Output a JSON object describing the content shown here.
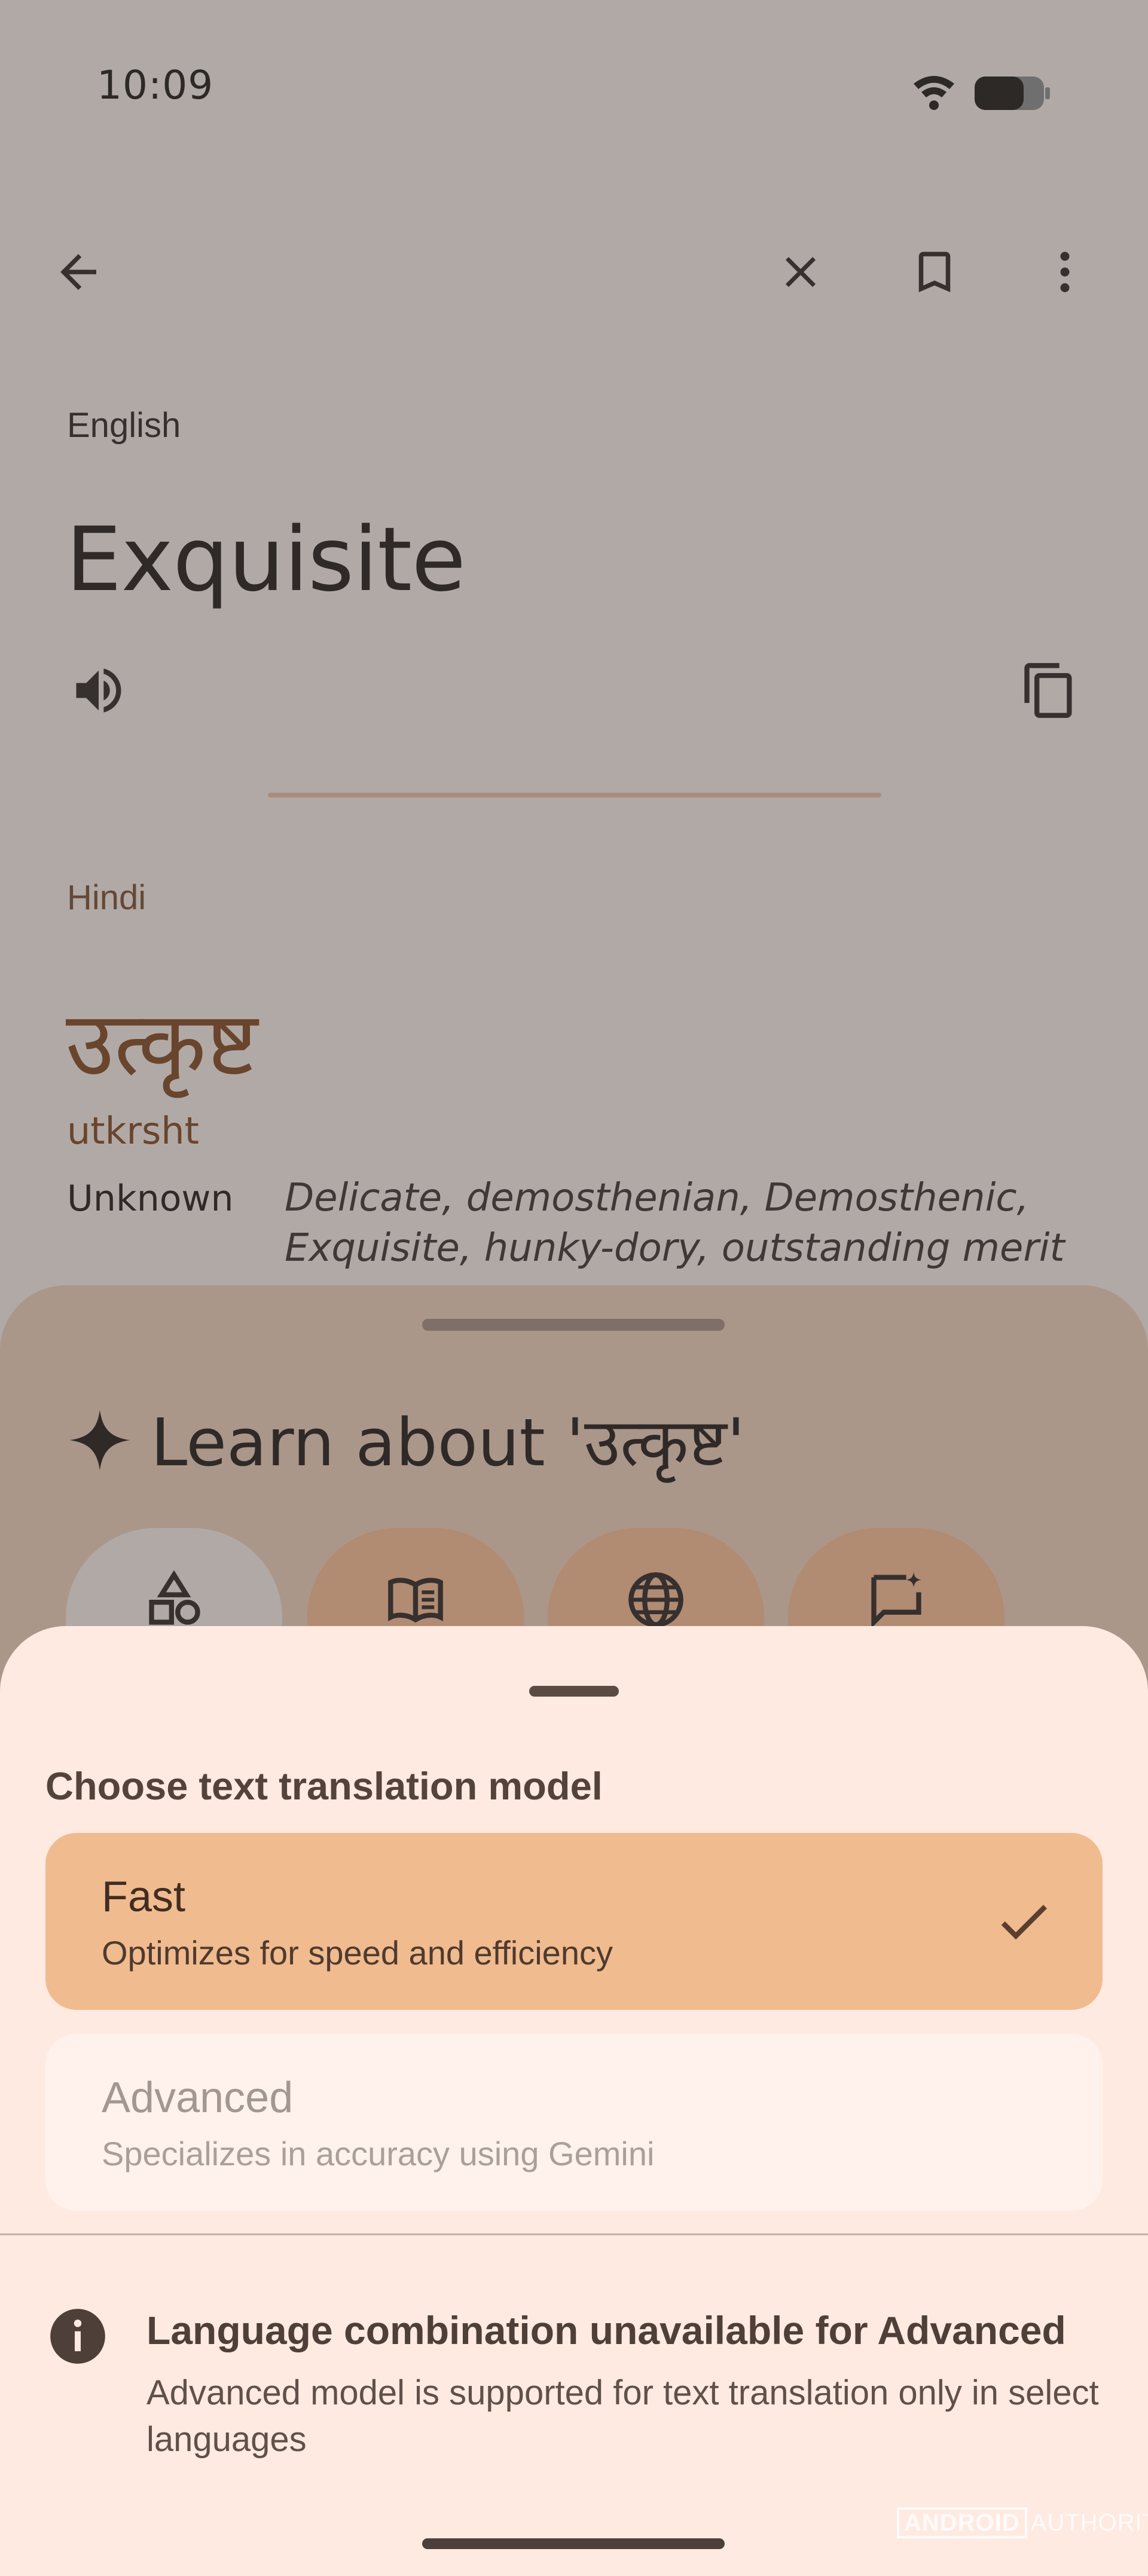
{
  "status_bar": {
    "time": "10:09",
    "icons": [
      "wifi-icon",
      "battery-icon"
    ]
  },
  "toolbar": {
    "icons": [
      "back-arrow-icon",
      "close-icon",
      "bookmark-icon",
      "more-vert-icon"
    ]
  },
  "translation": {
    "source_language": "English",
    "source_text": "Exquisite",
    "target_language": "Hindi",
    "target_text": "उत्कृष्ट",
    "transliteration": "utkrsht",
    "part_of_speech": "Unknown",
    "synonyms": "Delicate, demosthenian, Demosthenic, Exquisite, hunky-dory, outstanding merit"
  },
  "learn": {
    "title": "Learn about 'उत्कृष्ट'",
    "chips": [
      "shapes-icon",
      "book-icon",
      "globe-icon",
      "chat-sparkle-icon"
    ]
  },
  "model_sheet": {
    "title": "Choose text translation model",
    "options": [
      {
        "label": "Fast",
        "description": "Optimizes for speed and efficiency",
        "selected": true,
        "enabled": true
      },
      {
        "label": "Advanced",
        "description": "Specializes in accuracy using Gemini",
        "selected": false,
        "enabled": false
      }
    ],
    "notice_title": "Language combination unavailable for Advanced",
    "notice_body": "Advanced model is supported for text translation only in select languages"
  },
  "watermark": {
    "part1": "ANDROID",
    "part2": "AUTHORITY"
  },
  "colors": {
    "selected_option_bg": "#f0bb8f",
    "sheet_bg": "#ffeae1",
    "accent_text": "#84461e",
    "chip_bg": "#ffbe93"
  }
}
